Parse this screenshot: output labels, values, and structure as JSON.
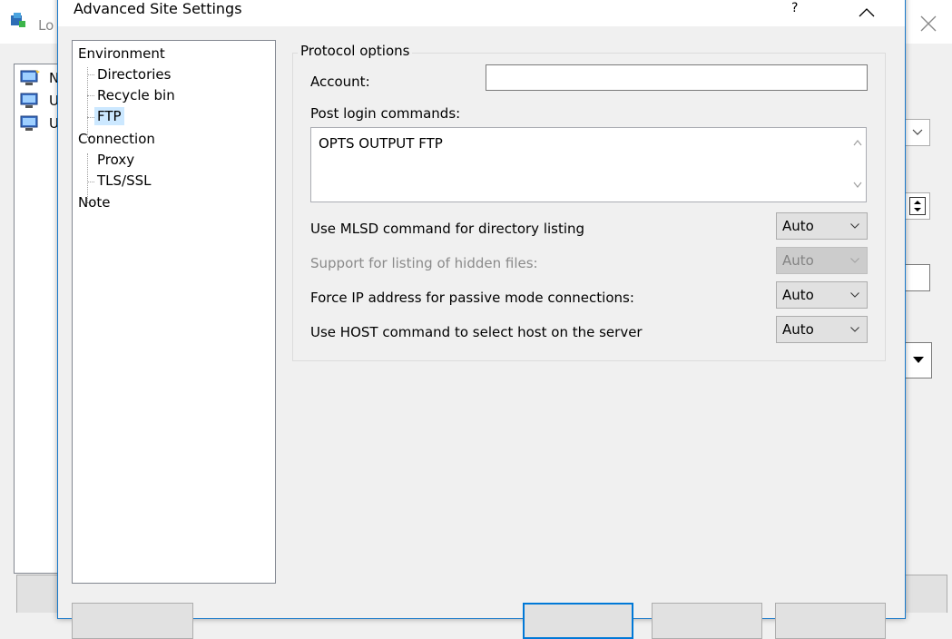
{
  "background_window": {
    "title": "Lo",
    "tree_nodes": [
      {
        "label": "N"
      },
      {
        "label": "U"
      },
      {
        "label": "U"
      }
    ]
  },
  "dialog": {
    "title": "Advanced Site Settings",
    "help_label": "?",
    "tree": {
      "items": [
        {
          "label": "Environment",
          "level": 0
        },
        {
          "label": "Directories",
          "level": 1
        },
        {
          "label": "Recycle bin",
          "level": 1
        },
        {
          "label": "FTP",
          "level": 1,
          "selected": true
        },
        {
          "label": "Connection",
          "level": 0
        },
        {
          "label": "Proxy",
          "level": 1
        },
        {
          "label": "TLS/SSL",
          "level": 1
        },
        {
          "label": "Note",
          "level": 0
        }
      ]
    },
    "protocol_options": {
      "group_title": "Protocol options",
      "account_label": "Account:",
      "account_value": "",
      "post_login_label": "Post login commands:",
      "post_login_value": "OPTS OUTPUT FTP",
      "mlsd_label": "Use MLSD command for directory listing",
      "mlsd_value": "Auto",
      "hidden_files_label": "Support for listing of hidden files:",
      "hidden_files_value": "Auto",
      "force_ip_label": "Force IP address for passive mode connections:",
      "force_ip_value": "Auto",
      "host_cmd_label": "Use HOST command to select host on the server",
      "host_cmd_value": "Auto"
    }
  },
  "colors": {
    "accent": "#0078d7",
    "selection": "#cce8ff",
    "dialog_border": "#1979ca"
  }
}
